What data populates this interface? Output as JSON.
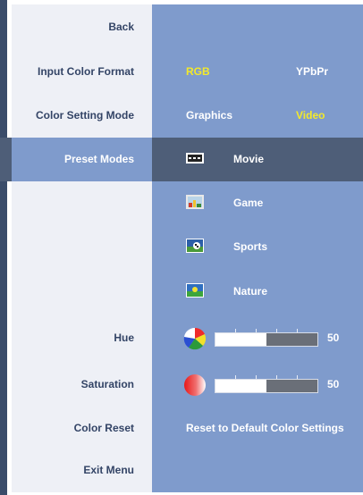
{
  "menu": {
    "back_label": "Back",
    "input_color_format": {
      "label": "Input Color Format",
      "options": [
        "RGB",
        "YPbPr"
      ],
      "selected": "RGB"
    },
    "color_setting_mode": {
      "label": "Color Setting Mode",
      "options": [
        "Graphics",
        "Video"
      ],
      "selected": "Video"
    },
    "preset_modes": {
      "label": "Preset Modes",
      "items": [
        "Movie",
        "Game",
        "Sports",
        "Nature"
      ],
      "highlighted": "Movie"
    },
    "hue": {
      "label": "Hue",
      "value": "50",
      "level": 0.5,
      "icon": "color-wheel-icon"
    },
    "saturation": {
      "label": "Saturation",
      "value": "50",
      "level": 0.5,
      "icon": "saturation-ball-icon"
    },
    "color_reset": {
      "label": "Color Reset",
      "action_text": "Reset to Default Color Settings"
    },
    "exit_label": "Exit Menu"
  },
  "colors": {
    "panel_blue": "#7f9bcc",
    "selected_row": "#4e5e78",
    "active_option": "#f3e92a",
    "label_text": "#334466"
  }
}
